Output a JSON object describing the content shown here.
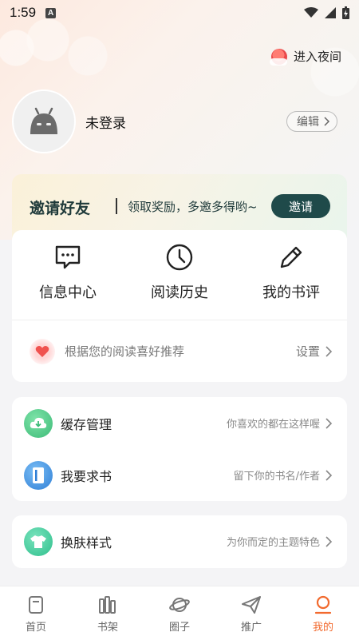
{
  "status_bar": {
    "time": "1:59",
    "notification_badge": "A"
  },
  "header": {
    "night_mode_label": "进入夜间"
  },
  "profile": {
    "username": "未登录",
    "edit_label": "编辑"
  },
  "invite": {
    "title": "邀请好友",
    "subtitle": "领取奖励，多邀多得哟~",
    "button_label": "邀请"
  },
  "quick_actions": [
    {
      "label": "信息中心",
      "icon": "message-icon"
    },
    {
      "label": "阅读历史",
      "icon": "clock-icon"
    },
    {
      "label": "我的书评",
      "icon": "pencil-icon"
    }
  ],
  "recommend": {
    "text": "根据您的阅读喜好推荐",
    "settings_label": "设置"
  },
  "list_group1": [
    {
      "title": "缓存管理",
      "subtitle": "你喜欢的都在这样喔",
      "icon": "cloud-download-icon",
      "color": "#4cc38a"
    },
    {
      "title": "我要求书",
      "subtitle": "留下你的书名/作者",
      "icon": "book-icon",
      "color": "#3d8fe0"
    }
  ],
  "list_group2": [
    {
      "title": "换肤样式",
      "subtitle": "为你而定的主题特色",
      "icon": "shirt-icon",
      "color": "#36c49a"
    }
  ],
  "tabs": [
    {
      "label": "首页",
      "icon": "home-icon"
    },
    {
      "label": "书架",
      "icon": "bookshelf-icon"
    },
    {
      "label": "圈子",
      "icon": "planet-icon"
    },
    {
      "label": "推广",
      "icon": "paper-plane-icon"
    },
    {
      "label": "我的",
      "icon": "user-icon",
      "active": true
    }
  ],
  "colors": {
    "accent": "#f26a2e",
    "invite_button": "#1f4a4a"
  }
}
